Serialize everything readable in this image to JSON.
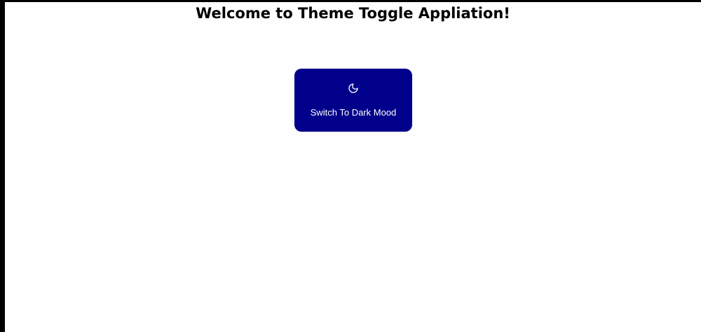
{
  "page": {
    "title": "Welcome to Theme Toggle Appliation!"
  },
  "toggle": {
    "label": "Switch To Dark Mood",
    "icon": "moon-icon",
    "background_color": "#00008b",
    "text_color": "#ffffff"
  }
}
